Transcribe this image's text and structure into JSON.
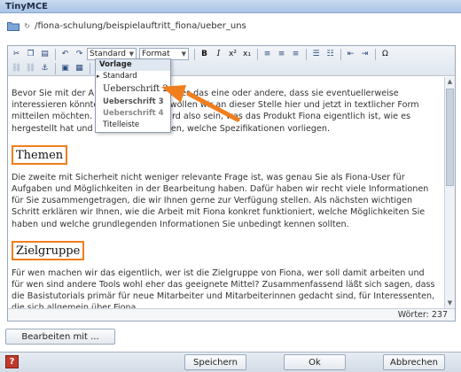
{
  "window": {
    "title": "TinyMCE"
  },
  "path": {
    "text": "/fiona-schulung/beispielauftritt_fiona/ueber_uns"
  },
  "toolbar": {
    "style_select": "Standard",
    "format_select": "Format",
    "row1_icons": [
      "cut-icon",
      "copy-icon",
      "paste-icon",
      "undo-icon",
      "redo-icon",
      "link-icon",
      "unlink-icon"
    ],
    "bold_label": "B",
    "italic_label": "I",
    "superscript_label": "x²",
    "subscript_label": "x₁",
    "omega_label": "Ω"
  },
  "dropdown": {
    "header": "Vorlage",
    "items": [
      "Standard",
      "Ueberschrift 2",
      "Ueberschrift 3",
      "Ueberschrift 4",
      "Titelleiste"
    ],
    "current": "Standard",
    "highlighted": "Ueberschrift 2"
  },
  "content": {
    "p1": "Bevor Sie mit der Arbeit beginnen, gibt es das eine oder andere, dass sie eventuellerweise interessieren könnte, und genau das wollen wir an dieser Stelle hier und jetzt in textlicher Form mitteilen möchten. Die erste Frage wird also sein, was das Produkt Fiona eigentlich ist, wie es hergestellt hat und wie wir es einsetzen, welche Spezifikationen vorliegen.",
    "h_themen": "Themen",
    "p2": "Die zweite mit Sicherheit nicht weniger relevante Frage ist, was genau Sie als Fiona-User für Aufgaben und Möglichkeiten in der Bearbeitung haben. Dafür haben wir recht viele Informationen für Sie zusammengetragen, die wir Ihnen gerne zur Verfügung stellen. Als nächsten wichtigen Schritt erklären wir Ihnen, wie die Arbeit mit Fiona konkret funktioniert, welche Möglichkeiten Sie haben und welche grundlegenden Informationen Sie unbedingt kennen sollten.",
    "h_zielgruppe": "Zielgruppe",
    "p3": "Für wen machen wir das eigentlich, wer ist die Zielgruppe von Fiona, wer soll damit arbeiten und für wen sind andere Tools wohl eher das geeignete Mittel? Zusammenfassend läßt sich sagen, dass die Basistutorials primär für neue Mitarbeiter und Mitarbeiterinnen gedacht sind, für Interessenten, die sich allgemein über Fiona"
  },
  "status": {
    "word_count": "Wörter: 237"
  },
  "buttons": {
    "edit_with": "Bearbeiten mit ...",
    "save": "Speichern",
    "ok": "Ok",
    "cancel": "Abbrechen",
    "help": "?"
  },
  "colors": {
    "accent": "#f07e1c",
    "titlebar": "#aac4e6",
    "link": "#2a4b7c"
  }
}
